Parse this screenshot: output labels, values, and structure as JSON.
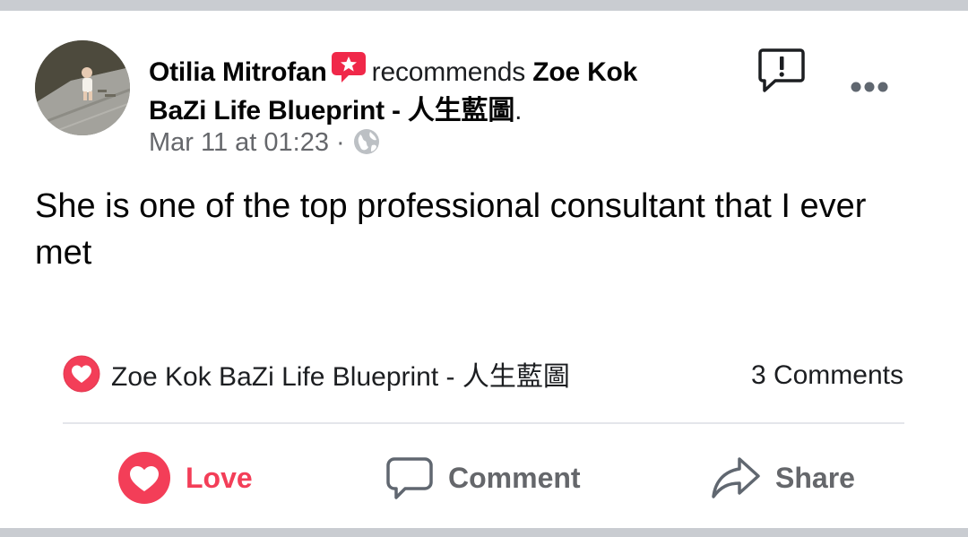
{
  "post": {
    "author": "Otilia Mitrofan",
    "action_text": "recommends",
    "page_name_line1": "Zoe Kok",
    "page_name_line2": "BaZi Life Blueprint - 人生藍圖",
    "page_name_suffix": ".",
    "timestamp": "Mar 11 at 01:23",
    "separator": "·",
    "body": "She is one of the top professional consultant that I ever met",
    "reaction_summary": "Zoe Kok BaZi Life Blueprint - 人生藍圖",
    "comments_count": "3 Comments"
  },
  "actions": {
    "love": "Love",
    "comment": "Comment",
    "share": "Share"
  },
  "icons": {
    "recommend": "recommend-star-icon",
    "privacy": "globe-icon",
    "report": "report-icon",
    "more": "more-options-icon",
    "reaction": "love-reaction-icon",
    "love": "heart-icon",
    "comment": "comment-icon",
    "share": "share-icon"
  },
  "colors": {
    "love": "#f33e58",
    "text_primary": "#050505",
    "text_secondary": "#65676b",
    "frame": "#c9ccd1"
  }
}
